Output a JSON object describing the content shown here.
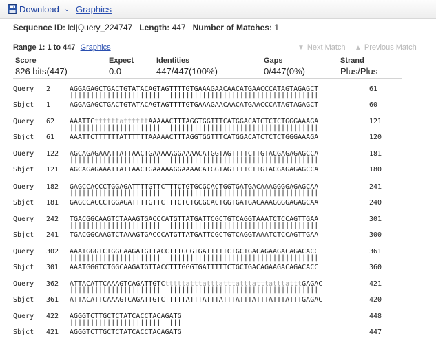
{
  "toolbar": {
    "download_label": "Download",
    "dropdown_icon": "chevron-down-icon",
    "graphics_label": "Graphics"
  },
  "sequence": {
    "id_label": "Sequence ID:",
    "id_value": "lcl|Query_224747",
    "length_label": "Length:",
    "length_value": "447",
    "matches_label": "Number of Matches:",
    "matches_value": "1"
  },
  "range": {
    "label": "Range 1: 1 to 447",
    "graphics_link": "Graphics",
    "next_match": "Next Match",
    "previous_match": "Previous Match"
  },
  "stats": {
    "headers": [
      "Score",
      "Expect",
      "Identities",
      "Gaps",
      "Strand"
    ],
    "values": [
      "826 bits(447)",
      "0.0",
      "447/447(100%)",
      "0/447(0%)",
      "Plus/Plus"
    ]
  },
  "alignment": [
    {
      "query_label": "Query",
      "query_start": "2",
      "query_seq": "AGGAGAGCTGACTGTATACAGTAGTTTTGTGAAAGAACAACATGAACCCATAGTAGAGCT",
      "query_end": "61",
      "match": "||||||||||||||||||||||||||||||||||||||||||||||||||||||||||||",
      "sbjct_label": "Sbjct",
      "sbjct_start": "1",
      "sbjct_seq": "AGGAGAGCTGACTGTATACAGTAGTTTTGTGAAAGAACAACATGAACCCATAGTAGAGCT",
      "sbjct_end": "60"
    },
    {
      "query_label": "Query",
      "query_start": "62",
      "query_seq": "AAATTCttttttattttttAAAAACTTTAGGTGGTTTCATGGACATCTCTCTGGGAAAGA",
      "query_end": "121",
      "match": "||||||||||||||||||||||||||||||||||||||||||||||||||||||||||||",
      "sbjct_label": "Sbjct",
      "sbjct_start": "61",
      "sbjct_seq": "AAATTCTTTTTTATTTTTTAAAAACTTTAGGTGGTTTCATGGACATCTCTCTGGGAAAGA",
      "sbjct_end": "120"
    },
    {
      "query_label": "Query",
      "query_start": "122",
      "query_seq": "AGCAGAGAAATTATTAACTGAAAAAGGAAAACATGGTAGTTTTCTTGTACGAGAGAGCCA",
      "query_end": "181",
      "match": "||||||||||||||||||||||||||||||||||||||||||||||||||||||||||||",
      "sbjct_label": "Sbjct",
      "sbjct_start": "121",
      "sbjct_seq": "AGCAGAGAAATTATTAACTGAAAAAGGAAAACATGGTAGTTTTCTTGTACGAGAGAGCCA",
      "sbjct_end": "180"
    },
    {
      "query_label": "Query",
      "query_start": "182",
      "query_seq": "GAGCCACCCTGGAGATTTTGTTCTTTCTGTGCGCACTGGTGATGACAAAGGGGAGAGCAA",
      "query_end": "241",
      "match": "||||||||||||||||||||||||||||||||||||||||||||||||||||||||||||",
      "sbjct_label": "Sbjct",
      "sbjct_start": "181",
      "sbjct_seq": "GAGCCACCCTGGAGATTTTGTTCTTTCTGTGCGCACTGGTGATGACAAAGGGGAGAGCAA",
      "sbjct_end": "240"
    },
    {
      "query_label": "Query",
      "query_start": "242",
      "query_seq": "TGACGGCAAGTCTAAAGTGACCCATGTTATGATTCGCTGTCAGGTAAATCTCCAGTTGAA",
      "query_end": "301",
      "match": "||||||||||||||||||||||||||||||||||||||||||||||||||||||||||||",
      "sbjct_label": "Sbjct",
      "sbjct_start": "241",
      "sbjct_seq": "TGACGGCAAGTCTAAAGTGACCCATGTTATGATTCGCTGTCAGGTAAATCTCCAGTTGAA",
      "sbjct_end": "300"
    },
    {
      "query_label": "Query",
      "query_start": "302",
      "query_seq": "AAATGGGTCTGGCAAGATGTTACCTTTGGGTGATTTTTCTGCTGACAGAAGACAGACACC",
      "query_end": "361",
      "match": "||||||||||||||||||||||||||||||||||||||||||||||||||||||||||||",
      "sbjct_label": "Sbjct",
      "sbjct_start": "301",
      "sbjct_seq": "AAATGGGTCTGGCAAGATGTTACCTTTGGGTGATTTTTCTGCTGACAGAAGACAGACACC",
      "sbjct_end": "360"
    },
    {
      "query_label": "Query",
      "query_start": "362",
      "query_seq": "ATTACATTCAAAGTCAGATTGTCtttttatttatttatttatttatttatttatttGAGAC",
      "query_end": "421",
      "match": "||||||||||||||||||||||||||||||||||||||||||||||||||||||||||||",
      "sbjct_label": "Sbjct",
      "sbjct_start": "361",
      "sbjct_seq": "ATTACATTCAAAGTCAGATTGTCTTTTTATTTATTTATTTATTTATTTATTTATTTGAGAC",
      "sbjct_end": "420"
    },
    {
      "query_label": "Query",
      "query_start": "422",
      "query_seq": "AGGGTCTTGCTCTATCACCTACAGATG",
      "query_end": "448",
      "match": "|||||||||||||||||||||||||||",
      "sbjct_label": "Sbjct",
      "sbjct_start": "421",
      "sbjct_seq": "AGGGTCTTGCTCTATCACCTACAGATG",
      "sbjct_end": "447"
    }
  ]
}
